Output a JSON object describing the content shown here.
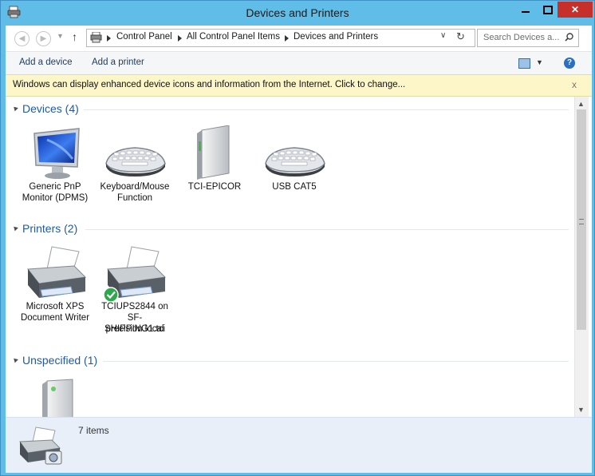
{
  "window": {
    "title": "Devices and Printers",
    "close_glyph": "✕",
    "icon": "devices-printers-icon"
  },
  "address": {
    "crumbs": [
      "Control Panel",
      "All Control Panel Items",
      "Devices and Printers"
    ],
    "search_placeholder": "Search Devices a..."
  },
  "toolbar": {
    "add_device": "Add a device",
    "add_printer": "Add a printer",
    "help_glyph": "?"
  },
  "infobar": {
    "text": "Windows can display enhanced device icons and information from the Internet. Click to change...",
    "close_glyph": "x"
  },
  "groups": {
    "devices": {
      "title": "Devices (4)",
      "items": [
        {
          "line1": "Generic PnP",
          "line2": "Monitor (DPMS)",
          "icon": "monitor-icon"
        },
        {
          "line1": "Keyboard/Mouse",
          "line2": "Function",
          "icon": "keyboard-icon"
        },
        {
          "line1": "TCI-EPICOR",
          "line2": "",
          "icon": "computer-tower-icon"
        },
        {
          "line1": "USB CAT5",
          "line2": "",
          "icon": "keyboard-icon"
        }
      ]
    },
    "printers": {
      "title": "Printers (2)",
      "items": [
        {
          "line1": "Microsoft XPS",
          "line2": "Document Writer",
          "line3": "",
          "icon": "printer-icon"
        },
        {
          "line1": "TCIUPS2844 on",
          "line2": "SF-SHIPPING1.tci",
          "line3": "precision.local",
          "icon": "printer-default-icon"
        }
      ]
    },
    "unspecified": {
      "title": "Unspecified (1)",
      "items": [
        {
          "icon": "server-icon"
        }
      ]
    }
  },
  "details": {
    "count": "7 items",
    "icon": "devices-printers-icon"
  },
  "colors": {
    "title_bar": "#5fbde8",
    "close_button": "#c7302a",
    "group_title": "#1e5aa8",
    "infobar": "#fcf6c9",
    "details_pane": "#e8eff8"
  }
}
